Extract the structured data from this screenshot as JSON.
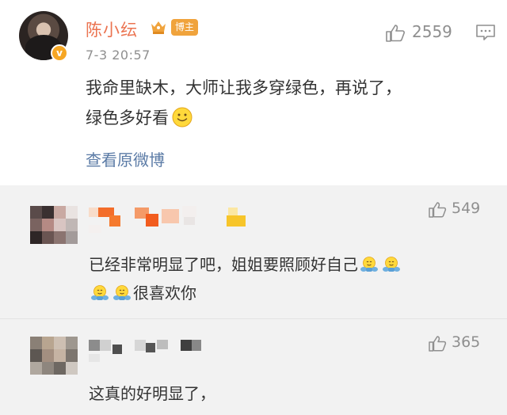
{
  "post": {
    "username": "陈小纭",
    "badge": "博主",
    "timestamp": "7-3 20:57",
    "like_count": "2559",
    "text_line1": "我命里缺木，大师让我多穿绿色，再说了，",
    "text_line2": "绿色多好看",
    "view_original": "查看原微博",
    "verified_mark": "v"
  },
  "comments": [
    {
      "like_count": "549",
      "text_line1": "已经非常明显了吧，姐姐要照顾好自己",
      "text_line2": "很喜欢你"
    },
    {
      "like_count": "365",
      "text": "这真的好明显了，"
    }
  ],
  "colors": {
    "username": "#eb7350",
    "link": "#5b7ba6",
    "muted": "#8f8f8f",
    "badge": "#f0a33c",
    "comment_bg": "#f2f2f2"
  },
  "icons": {
    "like": "thumbs-up-icon",
    "comment": "comment-bubble-icon",
    "crown": "crown-icon",
    "smile": "smile-emoji",
    "hug": "hug-emoji"
  }
}
